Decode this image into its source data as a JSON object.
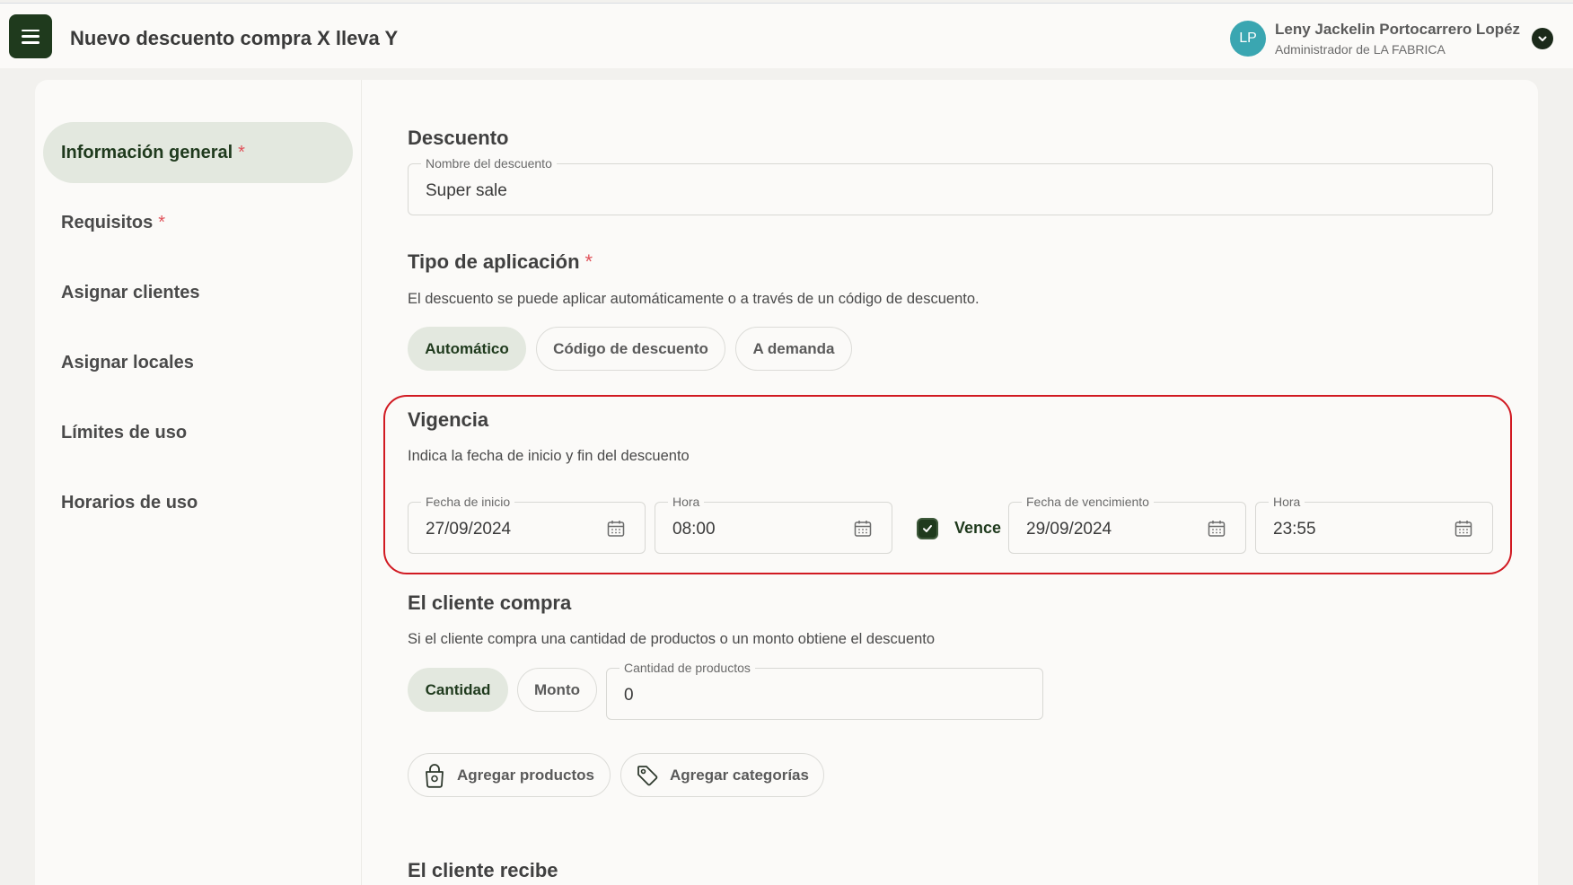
{
  "header": {
    "title": "Nuevo descuento compra X lleva Y",
    "menu_icon": "hamburger-menu-icon",
    "user": {
      "initials": "LP",
      "name": "Leny Jackelin Portocarrero Lopéz",
      "role": "Administrador de LA FABRICA",
      "avatar_color": "#3aa6b1"
    }
  },
  "sidebar": {
    "items": [
      {
        "label": "Información general",
        "required": "*",
        "active": true
      },
      {
        "label": "Requisitos",
        "required": "*",
        "active": false
      },
      {
        "label": "Asignar clientes",
        "required": "",
        "active": false
      },
      {
        "label": "Asignar locales",
        "required": "",
        "active": false
      },
      {
        "label": "Límites de uso",
        "required": "",
        "active": false
      },
      {
        "label": "Horarios de uso",
        "required": "",
        "active": false
      }
    ]
  },
  "descuento": {
    "title": "Descuento",
    "name_label": "Nombre del descuento",
    "name_value": "Super sale"
  },
  "tipo": {
    "title": "Tipo de aplicación",
    "required": "*",
    "description": "El descuento se puede aplicar automáticamente o a través de un código de descuento.",
    "options": [
      "Automático",
      "Código de descuento",
      "A demanda"
    ],
    "selected": "Automático"
  },
  "vigencia": {
    "title": "Vigencia",
    "description": "Indica la fecha de inicio y fin del descuento",
    "start_date_label": "Fecha de inicio",
    "start_date": "27/09/2024",
    "start_time_label": "Hora",
    "start_time": "08:00",
    "expires_label": "Vence",
    "expires_checked": true,
    "end_date_label": "Fecha de vencimiento",
    "end_date": "29/09/2024",
    "end_time_label": "Hora",
    "end_time": "23:55"
  },
  "cliente_compra": {
    "title": "El cliente compra",
    "description": "Si el cliente compra una cantidad de productos o un monto obtiene el descuento",
    "options": [
      "Cantidad",
      "Monto"
    ],
    "selected": "Cantidad",
    "quantity_label": "Cantidad de productos",
    "quantity_value": "0",
    "add_products": "Agregar productos",
    "add_categories": "Agregar categorías"
  },
  "cliente_recibe": {
    "title": "El cliente recibe"
  },
  "colors": {
    "primary_dark": "#1f3a1d",
    "chip_active_bg": "#e3e8df",
    "highlight_red": "#d11a22",
    "required_red": "#e0525a"
  }
}
